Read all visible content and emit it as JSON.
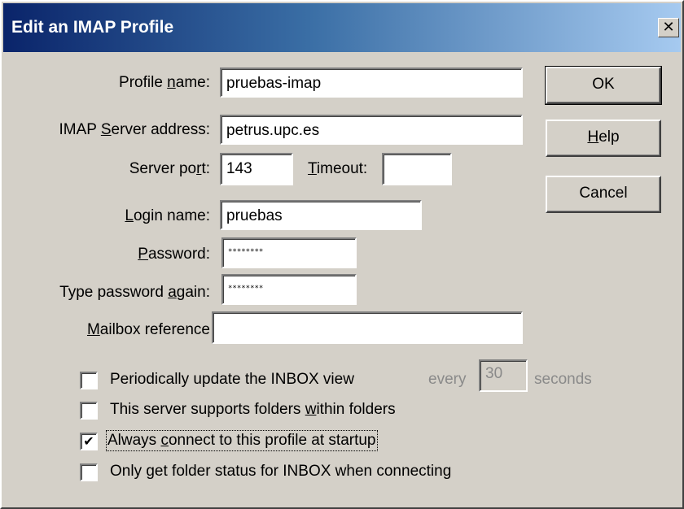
{
  "window": {
    "title": "Edit an IMAP Profile",
    "close_glyph": "✕"
  },
  "labels": {
    "profile_name": [
      "Profile ",
      "n",
      "ame:"
    ],
    "server_address": [
      "IMAP ",
      "S",
      "erver address:"
    ],
    "server_port": [
      "Server po",
      "r",
      "t:"
    ],
    "timeout": [
      "",
      "T",
      "imeout:"
    ],
    "login_name": [
      "",
      "L",
      "ogin name:"
    ],
    "password": [
      "",
      "P",
      "assword:"
    ],
    "password_again": [
      "Type password ",
      "a",
      "gain:"
    ],
    "mailbox_reference": [
      "",
      "M",
      "ailbox reference"
    ]
  },
  "fields": {
    "profile_name": "pruebas-imap",
    "server_address": "petrus.upc.es",
    "server_port": "143",
    "timeout": "",
    "login_name": "pruebas",
    "password": "********",
    "password_again": "********",
    "mailbox_reference": "",
    "update_interval": "30"
  },
  "buttons": {
    "ok": "OK",
    "help": [
      "",
      "H",
      "elp"
    ],
    "cancel": "Cancel"
  },
  "checkboxes": [
    {
      "label": [
        "Periodically update the INBOX view",
        "",
        ""
      ],
      "checked": false
    },
    {
      "label": [
        "This server supports folders ",
        "w",
        "ithin folders"
      ],
      "checked": false
    },
    {
      "label": [
        "Always ",
        "c",
        "onnect to this profile at startup"
      ],
      "checked": true
    },
    {
      "label": [
        "Only get folder status for INBOX when connecting",
        "",
        ""
      ],
      "checked": false
    }
  ],
  "interval": {
    "every": "every",
    "seconds": "seconds"
  }
}
